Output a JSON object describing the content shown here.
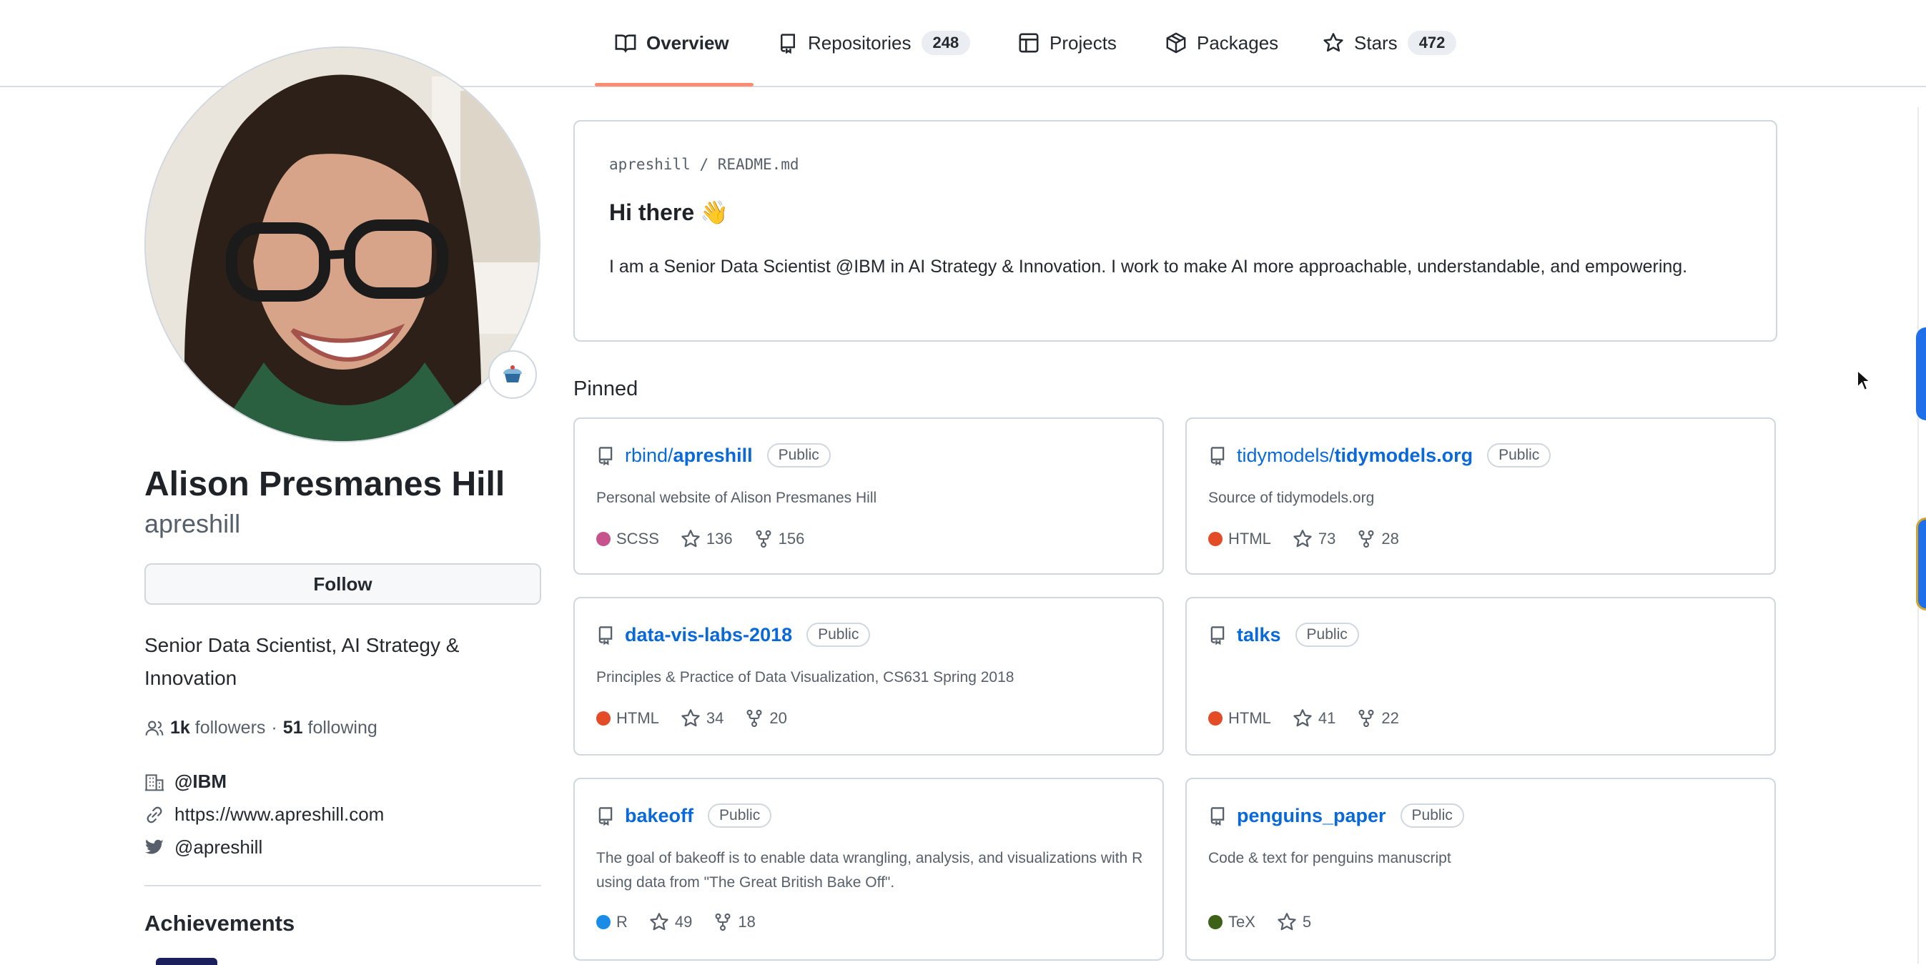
{
  "nav": {
    "tabs": [
      {
        "label": "Overview",
        "icon": "book-icon"
      },
      {
        "label": "Repositories",
        "count": "248",
        "icon": "repo-icon"
      },
      {
        "label": "Projects",
        "icon": "table-icon"
      },
      {
        "label": "Packages",
        "icon": "package-icon"
      },
      {
        "label": "Stars",
        "count": "472",
        "icon": "star-icon"
      }
    ],
    "active": "Overview"
  },
  "profile": {
    "name": "Alison Presmanes Hill",
    "login": "apreshill",
    "follow_label": "Follow",
    "bio": "Senior Data Scientist, AI Strategy & Innovation",
    "followers_count": "1k",
    "followers_label": "followers",
    "dot": "·",
    "following_count": "51",
    "following_label": "following",
    "company": "@IBM",
    "website": "https://www.apreshill.com",
    "twitter": "@apreshill",
    "achievements_label": "Achievements"
  },
  "readme": {
    "owner": "apreshill",
    "slash": "/",
    "file": "README.md",
    "title": "Hi there",
    "title_emoji": "👋",
    "body": "I am a Senior Data Scientist @IBM in AI Strategy & Innovation. I work to make AI more approachable, understandable, and empowering."
  },
  "pinned": {
    "label": "Pinned",
    "repos": [
      {
        "owner": "rbind/",
        "name": "apreshill",
        "visibility": "Public",
        "description": "Personal website of Alison Presmanes Hill",
        "language": "SCSS",
        "lang_color": "#c6538c",
        "stars": "136",
        "forks": "156"
      },
      {
        "owner": "tidymodels/",
        "name": "tidymodels.org",
        "visibility": "Public",
        "description": "Source of tidymodels.org",
        "language": "HTML",
        "lang_color": "#e34c26",
        "stars": "73",
        "forks": "28"
      },
      {
        "owner": "",
        "name": "data-vis-labs-2018",
        "visibility": "Public",
        "description": "Principles & Practice of Data Visualization, CS631 Spring 2018",
        "language": "HTML",
        "lang_color": "#e34c26",
        "stars": "34",
        "forks": "20"
      },
      {
        "owner": "",
        "name": "talks",
        "visibility": "Public",
        "description": "",
        "language": "HTML",
        "lang_color": "#e34c26",
        "stars": "41",
        "forks": "22"
      },
      {
        "owner": "",
        "name": "bakeoff",
        "visibility": "Public",
        "description": "The goal of bakeoff is to enable data wrangling, analysis, and visualizations with R using data from \"The Great British Bake Off\".",
        "language": "R",
        "lang_color": "#198ce7",
        "stars": "49",
        "forks": "18"
      },
      {
        "owner": "",
        "name": "penguins_paper",
        "visibility": "Public",
        "description": "Code & text for penguins manuscript",
        "language": "TeX",
        "lang_color": "#3d6117",
        "stars": "5",
        "forks": ""
      }
    ]
  }
}
